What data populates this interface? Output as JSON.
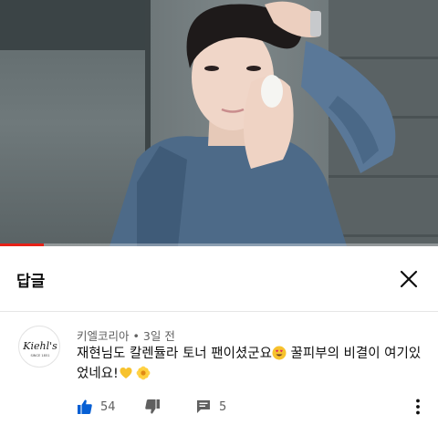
{
  "video": {
    "progress_fraction": 0.1,
    "accent": "#e62117"
  },
  "header": {
    "title": "답글",
    "close_icon": "close-icon"
  },
  "comment": {
    "author": "키엘코리아",
    "separator": "•",
    "time": "3일 전",
    "avatar_logo_text": "Kiehl's",
    "avatar_logo_sub": "SINCE 1851",
    "text_part1": "재현님도 칼렌듈라 토너 팬이셨군요",
    "text_part2": " 꿀피부의 비결이 여기있었네요!",
    "emojis": [
      "heart-eyes-emoji",
      "yellow-heart-emoji",
      "blossom-emoji"
    ],
    "likes": "54",
    "replies": "5"
  },
  "colors": {
    "like_blue": "#065fd4",
    "icon_gray": "#606060",
    "text": "#0f0f0f"
  }
}
